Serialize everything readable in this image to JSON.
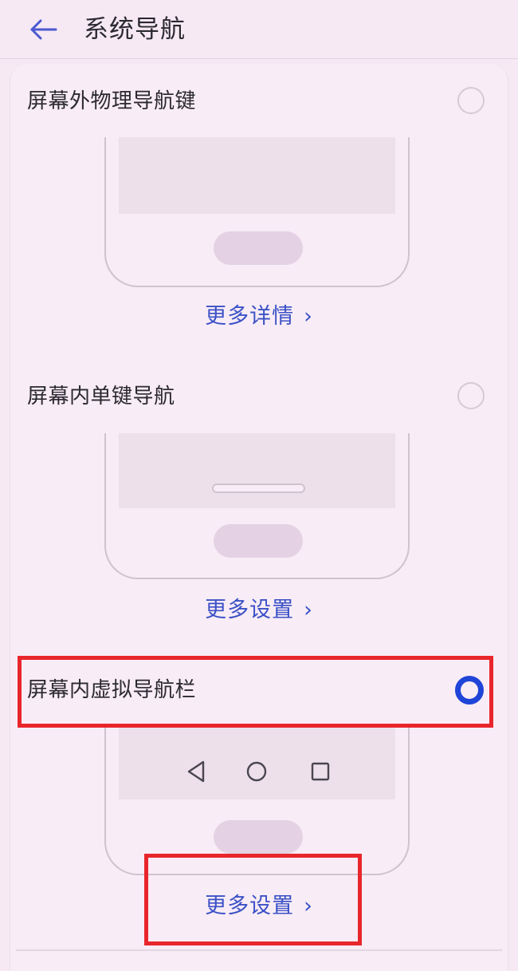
{
  "header": {
    "title": "系统导航"
  },
  "options": [
    {
      "label": "屏幕外物理导航键",
      "selected": false,
      "link": "更多详情"
    },
    {
      "label": "屏幕内单键导航",
      "selected": false,
      "link": "更多设置"
    },
    {
      "label": "屏幕内虚拟导航栏",
      "selected": true,
      "link": "更多设置"
    }
  ],
  "chevron": "›",
  "colors": {
    "accent": "#1e44d8",
    "link": "#3b51c6",
    "highlight": "#e8262b",
    "background": "#f6e9f4"
  }
}
